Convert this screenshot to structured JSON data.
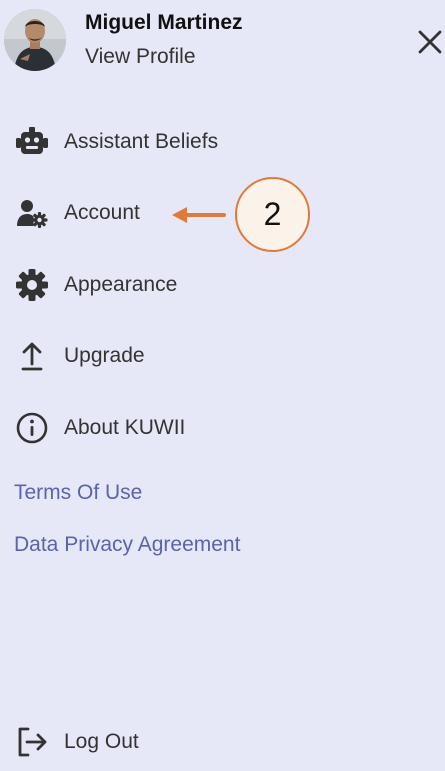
{
  "profile": {
    "name": "Miguel Martinez",
    "link": "View Profile"
  },
  "menu": {
    "items": [
      {
        "label": "Assistant Beliefs",
        "icon": "robot-icon"
      },
      {
        "label": "Account",
        "icon": "user-gear-icon"
      },
      {
        "label": "Appearance",
        "icon": "gear-icon"
      },
      {
        "label": "Upgrade",
        "icon": "upload-arrow-icon"
      },
      {
        "label": "About KUWII",
        "icon": "info-icon"
      }
    ]
  },
  "links": {
    "terms": "Terms Of Use",
    "privacy": "Data Privacy Agreement"
  },
  "logout": {
    "label": "Log Out",
    "icon": "logout-icon"
  },
  "annotation": {
    "number": "2"
  },
  "colors": {
    "background": "#e7e8f7",
    "link": "#5b62b0",
    "annotation_accent": "#e07a3c",
    "icon": "#333333"
  }
}
